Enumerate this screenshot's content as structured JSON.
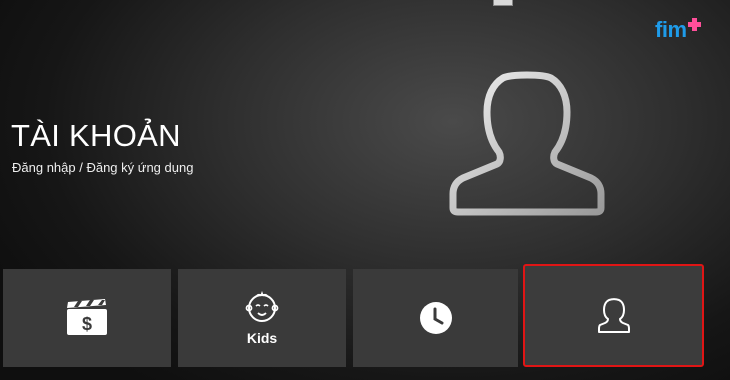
{
  "brand": {
    "logo_text": "fim",
    "accent": "#1e9be9",
    "plus_color": "#ff4f9a"
  },
  "header": {
    "title": "TÀI KHOẢN",
    "subtitle": "Đăng nhập / Đăng ký ứng dụng"
  },
  "hero": {
    "icon": "user-outline-icon"
  },
  "tiles": [
    {
      "icon": "movie-purchase-icon",
      "label": ""
    },
    {
      "icon": "kids-face-icon",
      "label": "Kids"
    },
    {
      "icon": "clock-icon",
      "label": ""
    },
    {
      "icon": "user-icon",
      "label": "",
      "selected": true
    }
  ],
  "colors": {
    "selection_border": "#e01515",
    "tile_bg": "#3a3a3a"
  }
}
